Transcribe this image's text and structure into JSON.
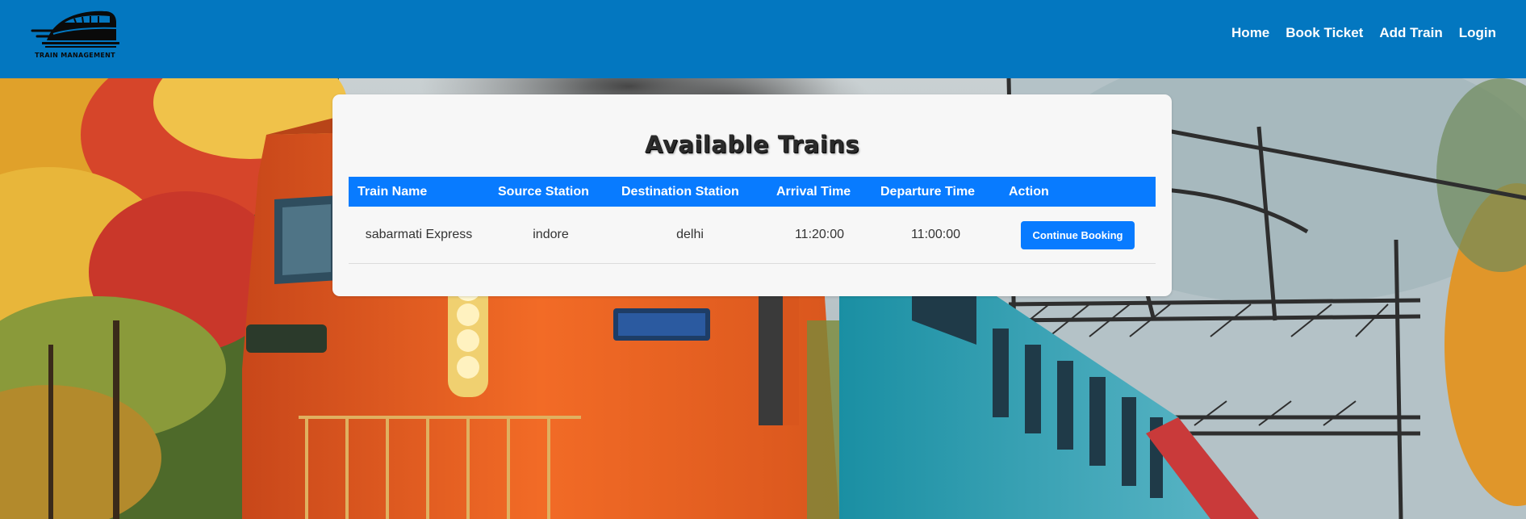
{
  "header": {
    "logo_text": "TRAIN MANAGEMENT",
    "nav": [
      {
        "label": "Home"
      },
      {
        "label": "Book Ticket"
      },
      {
        "label": "Add Train"
      },
      {
        "label": "Login"
      }
    ]
  },
  "main": {
    "title": "Available Trains",
    "table": {
      "headers": [
        "Train Name",
        "Source Station",
        "Destination Station",
        "Arrival Time",
        "Departure Time",
        "Action"
      ],
      "rows": [
        {
          "train_name": "sabarmati Express",
          "source": "indore",
          "destination": "delhi",
          "arrival": "11:20:00",
          "departure": "11:00:00",
          "action_label": "Continue Booking"
        }
      ]
    }
  },
  "colors": {
    "navbar": "#0377c0",
    "table_header": "#087bff",
    "button": "#087bff",
    "card_background": "#f7f7f7"
  }
}
